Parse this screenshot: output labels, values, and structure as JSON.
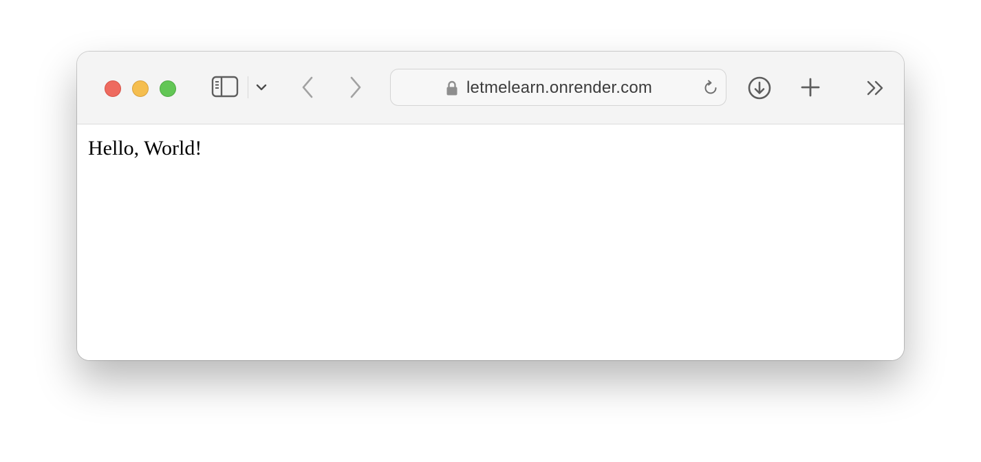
{
  "browser": {
    "address_bar": {
      "url": "letmelearn.onrender.com",
      "secure": true
    },
    "icons": {
      "sidebar": "sidebar-icon",
      "tab_overview": "chevron-down-icon",
      "back": "chevron-left-icon",
      "forward": "chevron-right-icon",
      "lock": "lock-icon",
      "reload": "reload-icon",
      "downloads": "download-icon",
      "new_tab": "plus-icon",
      "more": "double-chevron-right-icon"
    },
    "traffic_lights": {
      "close_color": "#ee6a5f",
      "minimize_color": "#f5be4f",
      "maximize_color": "#62c655"
    }
  },
  "page": {
    "text": "Hello, World!"
  }
}
